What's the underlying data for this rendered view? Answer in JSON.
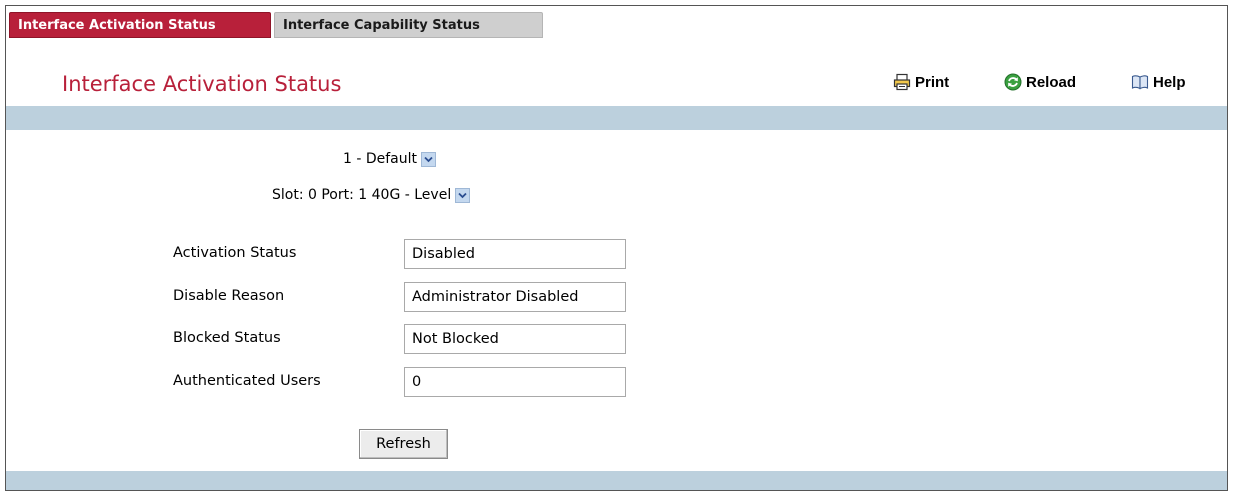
{
  "tabs": [
    {
      "label": "Interface Activation Status",
      "active": true
    },
    {
      "label": "Interface Capability Status",
      "active": false
    }
  ],
  "header": {
    "title": "Interface Activation Status",
    "print_label": "Print",
    "reload_label": "Reload",
    "help_label": "Help"
  },
  "selectors": {
    "vlan": "1 - Default",
    "port": "Slot: 0 Port: 1 40G - Level"
  },
  "fields": [
    {
      "label": "Activation Status",
      "value": "Disabled"
    },
    {
      "label": "Disable Reason",
      "value": "Administrator Disabled"
    },
    {
      "label": "Blocked Status",
      "value": "Not Blocked"
    },
    {
      "label": "Authenticated Users",
      "value": "0"
    }
  ],
  "actions": {
    "refresh_label": "Refresh"
  },
  "icons": {
    "print": "printer-icon",
    "reload": "reload-icon",
    "help": "help-book-icon",
    "dropdown": "chevron-down-icon"
  },
  "colors": {
    "accent": "#b8203a",
    "band": "#bcd0dd",
    "inactive_tab": "#cfcfcf"
  }
}
